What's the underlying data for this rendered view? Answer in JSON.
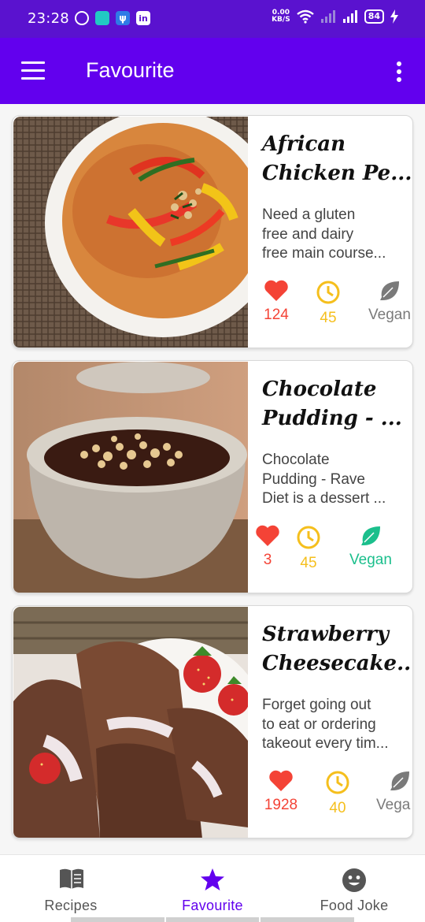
{
  "status_bar": {
    "time": "23:28",
    "net_speed_value": "0.00",
    "net_speed_unit": "KB/S",
    "battery": "84"
  },
  "app_bar": {
    "title": "Favourite",
    "menu_icon": "hamburger-menu-icon",
    "more_icon": "more-vert-icon"
  },
  "recipes": [
    {
      "title_lines": [
        "African",
        "Chicken Pe..."
      ],
      "description_lines": [
        "Need a gluten",
        "free and dairy",
        "free main course..."
      ],
      "likes": "124",
      "minutes": "45",
      "vegan_label": "Vegan",
      "vegan": false
    },
    {
      "title_lines": [
        "Chocolate",
        "Pudding - ..."
      ],
      "description_lines": [
        "Chocolate",
        "Pudding - Rave",
        "Diet is a dessert ..."
      ],
      "likes": "3",
      "minutes": "45",
      "vegan_label": "Vegan",
      "vegan": true
    },
    {
      "title_lines": [
        "Strawberry",
        "Cheesecake..."
      ],
      "description_lines": [
        "Forget going out",
        "to eat or ordering",
        "takeout every tim..."
      ],
      "likes": "1928",
      "minutes": "40",
      "vegan_label": "Vega",
      "vegan": false
    }
  ],
  "bottom_nav": [
    {
      "label": "Recipes",
      "icon": "menu-book-icon",
      "active": false
    },
    {
      "label": "Favourite",
      "icon": "star-icon",
      "active": true
    },
    {
      "label": "Food Joke",
      "icon": "smiley-face-icon",
      "active": false
    }
  ],
  "colors": {
    "primary": "#6200ee",
    "status_bar": "#5a12cf",
    "like_red": "#f44336",
    "time_yellow": "#f5bf1d",
    "vegan_green": "#1bbf8c",
    "inactive_grey": "#7a7a7a"
  }
}
